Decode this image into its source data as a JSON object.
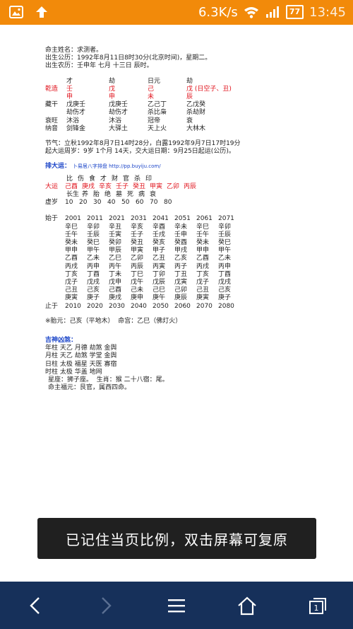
{
  "status_bar": {
    "net_speed": "6.3K/s",
    "battery": "77",
    "time": "13:45"
  },
  "header": [
    "命主姓名：求测者。",
    "出生公历：1992年8月11日8时30分(北京时间)，星期二。",
    "出生农历：壬申年 七月 十三日 辰时。"
  ],
  "bazi_table": {
    "ten_gods": [
      "才",
      "劫",
      "日元",
      "劫"
    ],
    "stems_label": "乾造",
    "stems": [
      "壬",
      "戊",
      "己",
      "戊"
    ],
    "stems_note": "(日空子、丑)",
    "branches": [
      "申",
      "申",
      "未",
      "辰"
    ],
    "rows": [
      {
        "label": "藏干",
        "cells": [
          "戊庚壬",
          "戊庚壬",
          "乙己丁",
          "乙戊癸"
        ]
      },
      {
        "label": "",
        "cells": [
          "劫伤才",
          "劫伤才",
          "杀比枭",
          "杀劫财"
        ]
      },
      {
        "label": "衰旺",
        "cells": [
          "沐浴",
          "沐浴",
          "冠帝",
          "衰"
        ]
      },
      {
        "label": "纳音",
        "cells": [
          "剑锋金",
          "大驿土",
          "天上火",
          "大林木"
        ]
      }
    ]
  },
  "jieqi": [
    "节气：立秋1992年8月7日14时28分，白露1992年9月7日17时19分",
    "起大运周岁：9岁 1个月 14天，交大运日期：9月25日起运(公历)。"
  ],
  "dayun": {
    "title": "排大运：",
    "link": "卜易居八字排盘 http://pp.buyiju.com/",
    "ten_gods": [
      "比",
      "伤",
      "食",
      "才",
      "财",
      "官",
      "杀",
      "印"
    ],
    "label": "大运",
    "pillars": [
      "己酉",
      "庚戌",
      "辛亥",
      "壬子",
      "癸丑",
      "甲寅",
      "乙卯",
      "丙辰"
    ],
    "states": [
      "长生",
      "养",
      "胎",
      "绝",
      "墓",
      "死",
      "病",
      "衰"
    ],
    "age_label": "虚岁",
    "ages": [
      "10",
      "20",
      "30",
      "40",
      "50",
      "60",
      "70",
      "80"
    ]
  },
  "liunian": {
    "start_label": "始于",
    "start_years": [
      "2001",
      "2011",
      "2021",
      "2031",
      "2041",
      "2051",
      "2061",
      "2071"
    ],
    "rows": [
      [
        "辛巳",
        "辛卯",
        "辛丑",
        "辛亥",
        "辛酉",
        "辛未",
        "辛巳",
        "辛卯"
      ],
      [
        "壬午",
        "壬辰",
        "壬寅",
        "壬子",
        "壬戌",
        "壬申",
        "壬午",
        "壬辰"
      ],
      [
        "癸未",
        "癸巳",
        "癸卯",
        "癸丑",
        "癸亥",
        "癸酉",
        "癸未",
        "癸巳"
      ],
      [
        "甲申",
        "甲午",
        "甲辰",
        "甲寅",
        "甲子",
        "甲戌",
        "甲申",
        "甲午"
      ],
      [
        "乙酉",
        "乙未",
        "乙巳",
        "乙卯",
        "乙丑",
        "乙亥",
        "乙酉",
        "乙未"
      ],
      [
        "丙戌",
        "丙申",
        "丙午",
        "丙辰",
        "丙寅",
        "丙子",
        "丙戌",
        "丙申"
      ],
      [
        "丁亥",
        "丁酉",
        "丁未",
        "丁巳",
        "丁卯",
        "丁丑",
        "丁亥",
        "丁酉"
      ],
      [
        "戊子",
        "戊戌",
        "戊申",
        "戊午",
        "戊辰",
        "戊寅",
        "戊子",
        "戊戌"
      ],
      [
        "己丑",
        "己亥",
        "己酉",
        "己未",
        "己巳",
        "己卯",
        "己丑",
        "己亥"
      ],
      [
        "庚寅",
        "庚子",
        "庚戌",
        "庚申",
        "庚午",
        "庚辰",
        "庚寅",
        "庚子"
      ]
    ],
    "end_label": "止于",
    "end_years": [
      "2010",
      "2020",
      "2030",
      "2040",
      "2050",
      "2060",
      "2070",
      "2080"
    ]
  },
  "taiyuan": "※胎元：己亥（平地木）  命宫：乙巳（佛灯火）",
  "shensha": {
    "title": "吉神凶煞：",
    "lines": [
      "年柱 天乙 月德 劫煞 金舆",
      "月柱 天乙 劫煞 学堂 金舆",
      "日柱 太极 福星 天医 寡宿",
      "时柱 太极 华盖 地网"
    ],
    "extra": [
      "星座：狮子座。  生肖：猴 二十八宿：尾。",
      "命主福元：艮官，属西四命。"
    ]
  },
  "toast": "已记住当页比例，双击屏幕可复原",
  "nav": {
    "tab_count": "1"
  },
  "colors": {
    "status_bar": "#f28a0a",
    "nav_bar": "#16305a",
    "accent_red": "#e0121b",
    "accent_blue": "#1a44c8"
  }
}
